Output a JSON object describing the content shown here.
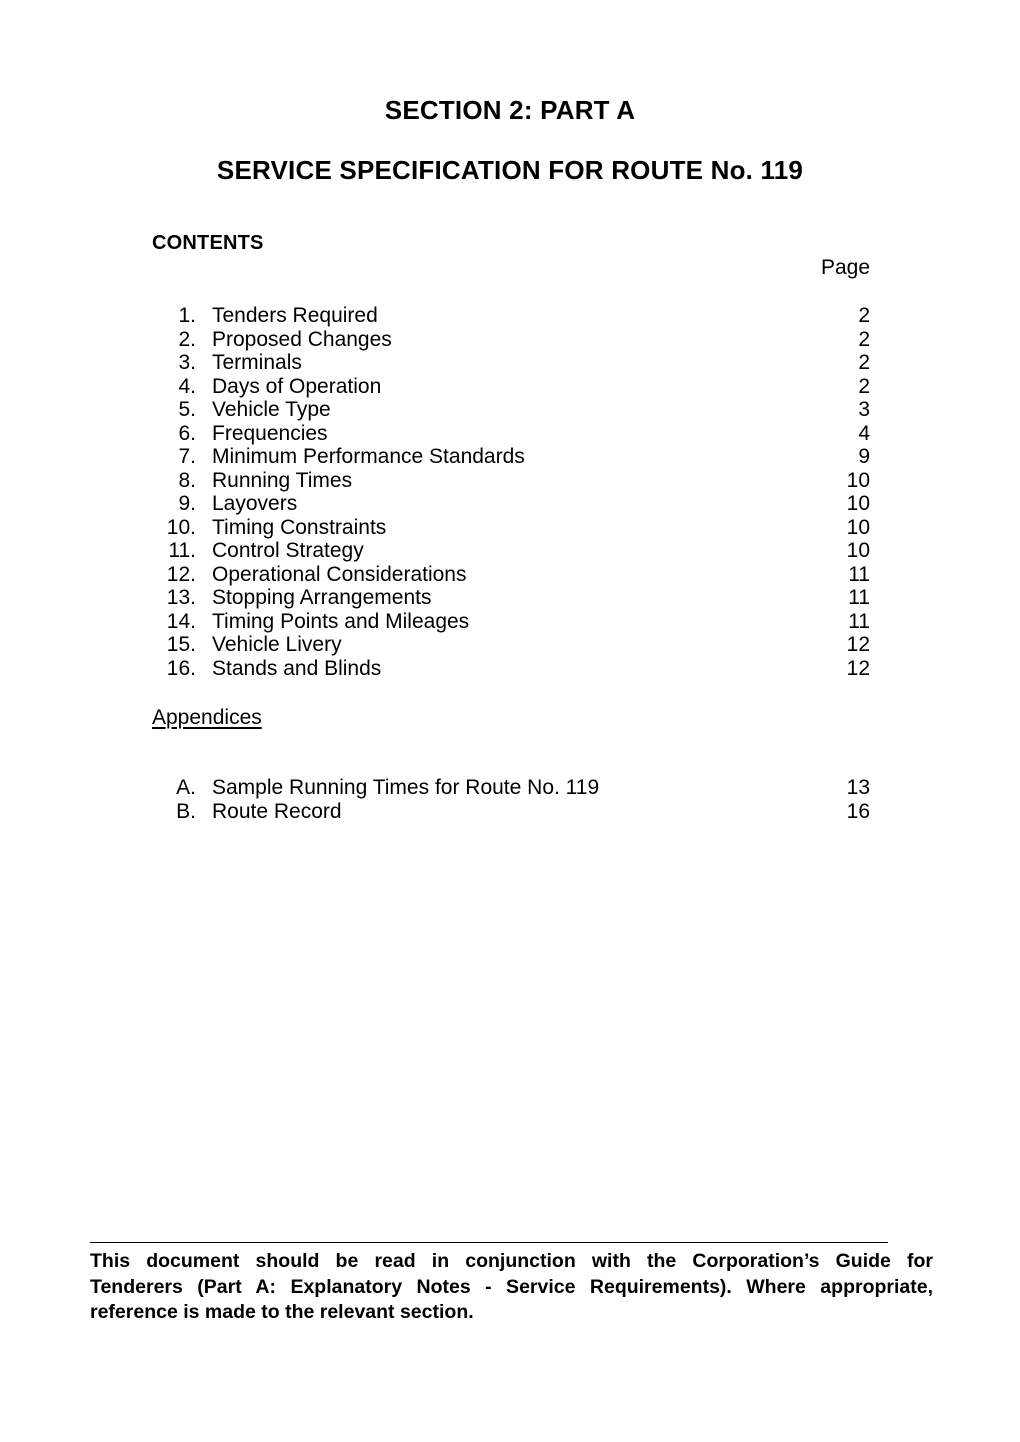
{
  "document": {
    "title_line_1": "SECTION 2: PART A",
    "title_line_2": "SERVICE SPECIFICATION FOR ROUTE No. 119"
  },
  "contents": {
    "heading": "CONTENTS",
    "page_column_header": "Page",
    "items": [
      {
        "number": "1.",
        "label": "Tenders Required",
        "page": "2"
      },
      {
        "number": "2.",
        "label": "Proposed Changes",
        "page": "2"
      },
      {
        "number": "3.",
        "label": "Terminals",
        "page": "2"
      },
      {
        "number": "4.",
        "label": "Days of Operation",
        "page": "2"
      },
      {
        "number": "5.",
        "label": "Vehicle Type",
        "page": "3"
      },
      {
        "number": "6.",
        "label": "Frequencies",
        "page": "4"
      },
      {
        "number": "7.",
        "label": "Minimum Performance Standards",
        "page": "9"
      },
      {
        "number": "8.",
        "label": "Running Times",
        "page": "10"
      },
      {
        "number": "9.",
        "label": "Layovers",
        "page": "10"
      },
      {
        "number": "10.",
        "label": "Timing Constraints",
        "page": "10"
      },
      {
        "number": "11.",
        "label": "Control Strategy",
        "page": "10"
      },
      {
        "number": "12.",
        "label": "Operational Considerations",
        "page": "11"
      },
      {
        "number": "13.",
        "label": "Stopping Arrangements",
        "page": "11"
      },
      {
        "number": "14.",
        "label": "Timing Points and Mileages",
        "page": "11"
      },
      {
        "number": "15.",
        "label": "Vehicle Livery",
        "page": "12"
      },
      {
        "number": "16.",
        "label": "Stands and Blinds",
        "page": "12"
      }
    ]
  },
  "appendices": {
    "heading": "Appendices",
    "items": [
      {
        "number": "A.",
        "label": "Sample Running Times for Route No. 119",
        "page": "13"
      },
      {
        "number": "B.",
        "label": "Route Record",
        "page": "16"
      }
    ]
  },
  "footer": {
    "line_1": "This document should be read in conjunction with the Corporation’s Guide for",
    "line_2": "Tenderers (Part A: Explanatory Notes - Service Requirements).  Where appropriate,",
    "line_3": "reference is made to the relevant section."
  }
}
